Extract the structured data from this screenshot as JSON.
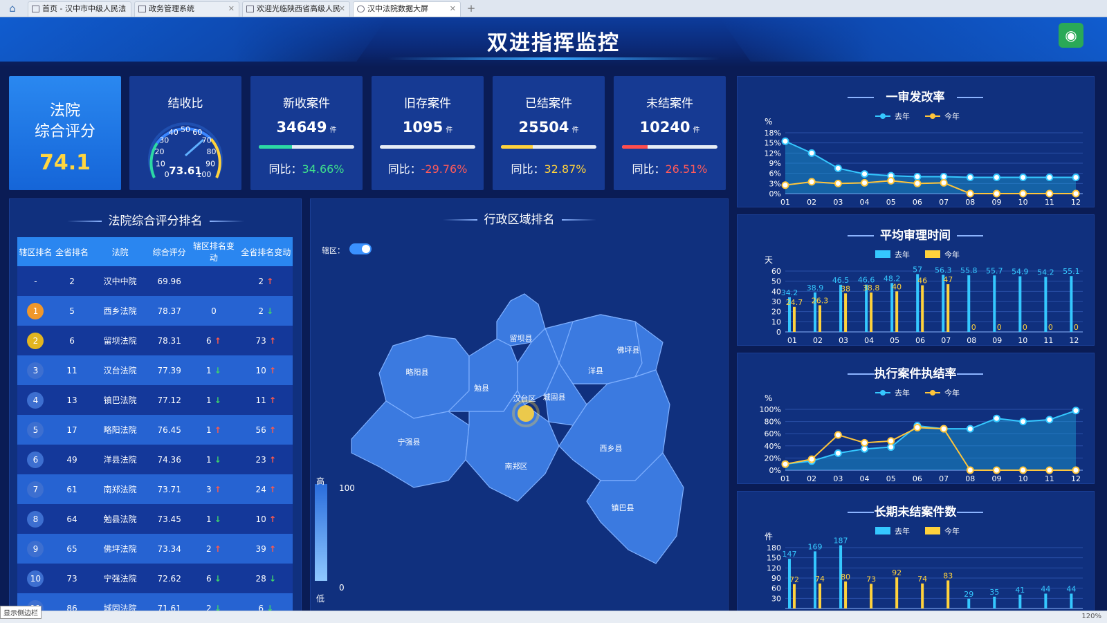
{
  "browser": {
    "tabs": [
      {
        "label": "首页 - 汉中市中级人民法",
        "active": false
      },
      {
        "label": "政务管理系统",
        "active": false
      },
      {
        "label": "欢迎光临陕西省高级人民",
        "active": false
      },
      {
        "label": "汉中法院数据大屏",
        "active": true
      }
    ]
  },
  "header": {
    "title": "双进指挥监控"
  },
  "score_card": {
    "label_line1": "法院",
    "label_line2": "综合评分",
    "value": "74.1"
  },
  "gauge": {
    "title": "结收比",
    "value": "73.61",
    "ticks": [
      "0",
      "10",
      "20",
      "30",
      "40",
      "50",
      "60",
      "70",
      "80",
      "90",
      "100"
    ]
  },
  "kpis": [
    {
      "title": "新收案件",
      "value": "34649",
      "unit": "件",
      "yoy_label": "同比：",
      "yoy": "34.66%",
      "yoy_color": "#3fe08c",
      "bar_color": "#2cd9a4",
      "bar_fraction": 0.35
    },
    {
      "title": "旧存案件",
      "value": "1095",
      "unit": "件",
      "yoy_label": "同比：",
      "yoy": "-29.76%",
      "yoy_color": "#ff5a5a",
      "bar_color": "#e6ecf5",
      "bar_fraction": 0.0
    },
    {
      "title": "已结案件",
      "value": "25504",
      "unit": "件",
      "yoy_label": "同比：",
      "yoy": "32.87%",
      "yoy_color": "#ffd23c",
      "bar_color": "#ffd23c",
      "bar_fraction": 0.33
    },
    {
      "title": "未结案件",
      "value": "10240",
      "unit": "件",
      "yoy_label": "同比：",
      "yoy": "26.51%",
      "yoy_color": "#ff5a5a",
      "bar_color": "#ff4d4d",
      "bar_fraction": 0.27
    }
  ],
  "ranking": {
    "title": "法院综合评分排名",
    "headers": [
      "辖区排名",
      "全省排名",
      "法院",
      "综合评分",
      "辖区排名变动",
      "全省排名变动"
    ],
    "rows": [
      {
        "rank": "-",
        "prov": "2",
        "court": "汉中中院",
        "score": "69.96",
        "d1": "",
        "d1dir": "",
        "d2": "2",
        "d2dir": "up"
      },
      {
        "rank": "1",
        "prov": "5",
        "court": "西乡法院",
        "score": "78.37",
        "d1": "0",
        "d1dir": "",
        "d2": "2",
        "d2dir": "down"
      },
      {
        "rank": "2",
        "prov": "6",
        "court": "留坝法院",
        "score": "78.31",
        "d1": "6",
        "d1dir": "up",
        "d2": "73",
        "d2dir": "up"
      },
      {
        "rank": "3",
        "prov": "11",
        "court": "汉台法院",
        "score": "77.39",
        "d1": "1",
        "d1dir": "down",
        "d2": "10",
        "d2dir": "up"
      },
      {
        "rank": "4",
        "prov": "13",
        "court": "镇巴法院",
        "score": "77.12",
        "d1": "1",
        "d1dir": "down",
        "d2": "11",
        "d2dir": "up"
      },
      {
        "rank": "5",
        "prov": "17",
        "court": "略阳法院",
        "score": "76.45",
        "d1": "1",
        "d1dir": "up",
        "d2": "56",
        "d2dir": "up"
      },
      {
        "rank": "6",
        "prov": "49",
        "court": "洋县法院",
        "score": "74.36",
        "d1": "1",
        "d1dir": "down",
        "d2": "23",
        "d2dir": "up"
      },
      {
        "rank": "7",
        "prov": "61",
        "court": "南郑法院",
        "score": "73.71",
        "d1": "3",
        "d1dir": "up",
        "d2": "24",
        "d2dir": "up"
      },
      {
        "rank": "8",
        "prov": "64",
        "court": "勉县法院",
        "score": "73.45",
        "d1": "1",
        "d1dir": "down",
        "d2": "10",
        "d2dir": "up"
      },
      {
        "rank": "9",
        "prov": "65",
        "court": "佛坪法院",
        "score": "73.34",
        "d1": "2",
        "d1dir": "up",
        "d2": "39",
        "d2dir": "up"
      },
      {
        "rank": "10",
        "prov": "73",
        "court": "宁强法院",
        "score": "72.62",
        "d1": "6",
        "d1dir": "down",
        "d2": "28",
        "d2dir": "down"
      },
      {
        "rank": "11",
        "prov": "86",
        "court": "城固法院",
        "score": "71.61",
        "d1": "2",
        "d1dir": "down",
        "d2": "6",
        "d2dir": "down"
      }
    ],
    "badge_colors": {
      "1": "#f0972a",
      "2": "#e2b520"
    }
  },
  "map": {
    "title": "行政区域排名",
    "toggle_label": "辖区：",
    "regions": [
      "留坝县",
      "佛坪县",
      "略阳县",
      "勉县",
      "汉台区",
      "城固县",
      "洋县",
      "宁强县",
      "南郑区",
      "西乡县",
      "镇巴县"
    ],
    "legend": {
      "high_label": "高",
      "low_label": "低",
      "max": "100",
      "min": "0"
    }
  },
  "chart_data": [
    {
      "type": "area",
      "title": "一审发改率",
      "ylabel": "%",
      "categories": [
        "01",
        "02",
        "03",
        "04",
        "05",
        "06",
        "07",
        "08",
        "09",
        "10",
        "11",
        "12"
      ],
      "y_ticks": [
        "0%",
        "3%",
        "6%",
        "9%",
        "12%",
        "15%",
        "18%"
      ],
      "ylim": [
        0,
        18
      ],
      "series": [
        {
          "name": "去年",
          "color": "#35c8ff",
          "values": [
            15.5,
            12,
            7.5,
            5.8,
            5.3,
            5,
            5,
            4.8,
            4.8,
            4.8,
            4.8,
            4.8
          ]
        },
        {
          "name": "今年",
          "color": "#ffc53a",
          "values": [
            2.5,
            3.5,
            3,
            3.2,
            3.8,
            3,
            3.2,
            0,
            0,
            0,
            0,
            0
          ]
        }
      ]
    },
    {
      "type": "bar",
      "title": "平均审理时间",
      "ylabel": "天",
      "categories": [
        "01",
        "02",
        "03",
        "04",
        "05",
        "06",
        "07",
        "08",
        "09",
        "10",
        "11",
        "12"
      ],
      "y_ticks": [
        "0",
        "10",
        "20",
        "30",
        "40",
        "50",
        "60"
      ],
      "ylim": [
        0,
        60
      ],
      "series": [
        {
          "name": "去年",
          "color": "#35c8ff",
          "values": [
            34.2,
            38.9,
            46.5,
            46.6,
            48.2,
            57,
            56.3,
            55.8,
            55.7,
            54.9,
            54.2,
            55.1
          ],
          "labels": [
            "34.2",
            "38.9",
            "46.5",
            "46.6",
            "48.2",
            "57",
            "56.3",
            "55.8",
            "55.7",
            "54.9",
            "54.2",
            "55.1"
          ]
        },
        {
          "name": "今年",
          "color": "#ffd23c",
          "values": [
            24.7,
            26.3,
            38,
            38.8,
            40,
            46,
            47,
            0,
            0,
            0,
            0,
            0
          ],
          "labels": [
            "24.7",
            "26.3",
            "38",
            "38.8",
            "40",
            "46",
            "47",
            "0",
            "0",
            "0",
            "0",
            "0"
          ]
        }
      ]
    },
    {
      "type": "area",
      "title": "执行案件执结率",
      "ylabel": "%",
      "categories": [
        "01",
        "02",
        "03",
        "04",
        "05",
        "06",
        "07",
        "08",
        "09",
        "10",
        "11",
        "12"
      ],
      "y_ticks": [
        "0%",
        "20%",
        "40%",
        "60%",
        "80%",
        "100%"
      ],
      "ylim": [
        0,
        100
      ],
      "series": [
        {
          "name": "去年",
          "color": "#35c8ff",
          "values": [
            10,
            15,
            28,
            35,
            38,
            73,
            68,
            68,
            85,
            80,
            83,
            98
          ]
        },
        {
          "name": "今年",
          "color": "#ffc53a",
          "values": [
            10,
            18,
            58,
            45,
            48,
            70,
            68,
            0,
            0,
            0,
            0,
            0
          ]
        }
      ]
    },
    {
      "type": "bar",
      "title": "长期未结案件数",
      "ylabel": "件",
      "categories": [
        "01",
        "02",
        "03",
        "04",
        "05",
        "06",
        "07",
        "08",
        "09",
        "10",
        "11",
        "12"
      ],
      "y_ticks": [
        "30",
        "60",
        "90",
        "120",
        "150",
        "180"
      ],
      "ylim": [
        0,
        180
      ],
      "series": [
        {
          "name": "去年",
          "color": "#35c8ff",
          "values": [
            147,
            169,
            187,
            0,
            0,
            0,
            0,
            29,
            35,
            41,
            44,
            44
          ],
          "labels": [
            "147",
            "169",
            "187",
            "",
            "",
            "",
            "",
            "29",
            "35",
            "41",
            "44",
            "44"
          ]
        },
        {
          "name": "今年",
          "color": "#ffd23c",
          "values": [
            72,
            74,
            80,
            73,
            92,
            74,
            83,
            0,
            0,
            0,
            0,
            0
          ],
          "labels": [
            "72",
            "74",
            "80",
            "73",
            "92",
            "74",
            "83",
            "",
            "",
            "",
            "",
            ""
          ]
        }
      ]
    }
  ],
  "statusbar": {
    "sidebar_tip": "显示侧边栏",
    "zoom": "120%"
  }
}
